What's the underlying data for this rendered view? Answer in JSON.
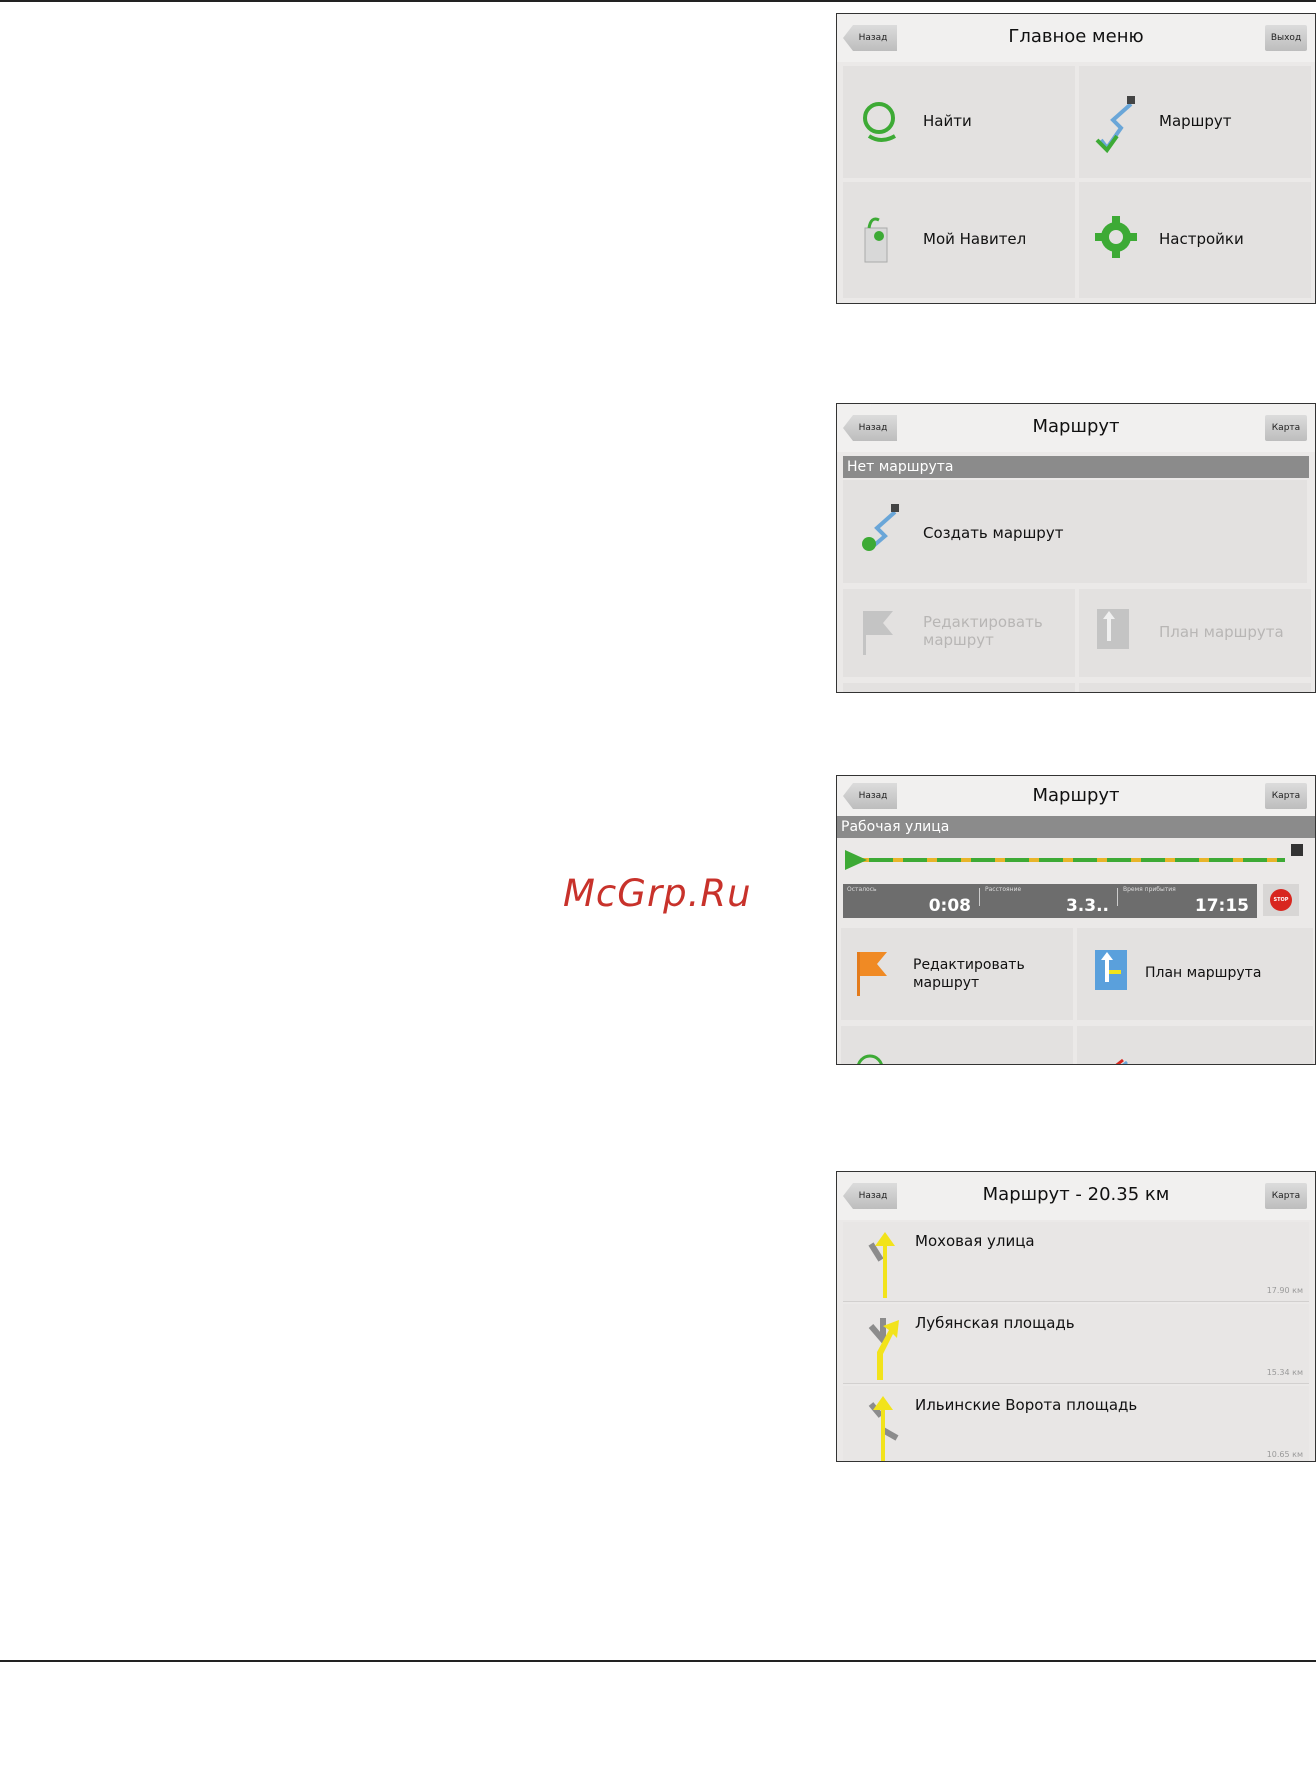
{
  "screens": [
    {
      "title": "Главное меню",
      "back_label": "Назад",
      "right_label": "Выход",
      "tiles": [
        {
          "label": "Найти",
          "icon": "search-icon"
        },
        {
          "label": "Маршрут",
          "icon": "route-icon"
        },
        {
          "label": "Мой Навител",
          "icon": "bag-icon"
        },
        {
          "label": "Настройки",
          "icon": "gear-icon"
        }
      ]
    },
    {
      "title": "Маршрут",
      "back_label": "Назад",
      "right_label": "Карта",
      "section": "Нет маршрута",
      "create_label": "Создать маршрут",
      "edit_label": "Редактировать маршрут",
      "plan_label": "План маршрута"
    },
    {
      "title": "Маршрут",
      "back_label": "Назад",
      "right_label": "Карта",
      "section": "Рабочая улица",
      "info": [
        {
          "caption": "Осталось",
          "value": "0:08"
        },
        {
          "caption": "Расстояние",
          "value": "3.3.."
        },
        {
          "caption": "Время прибытия",
          "value": "17:15"
        }
      ],
      "stop_label": "STOP",
      "edit_label": "Редактировать маршрут",
      "plan_label": "План маршрута"
    },
    {
      "title": "Маршрут - 20.35 км",
      "back_label": "Назад",
      "right_label": "Карта",
      "items": [
        {
          "name": "Моховая улица",
          "distance": "17.90 км"
        },
        {
          "name": "Лубянская площадь",
          "distance": "15.34 км"
        },
        {
          "name": "Ильинские Ворота площадь",
          "distance": "10.65 км"
        }
      ]
    }
  ],
  "watermark": "McGrp.Ru",
  "colors": {
    "accent_green": "#3daa35",
    "section_gray": "#8b8b8b",
    "stop_red": "#d8261f",
    "turn_yellow": "#f2e31b"
  }
}
